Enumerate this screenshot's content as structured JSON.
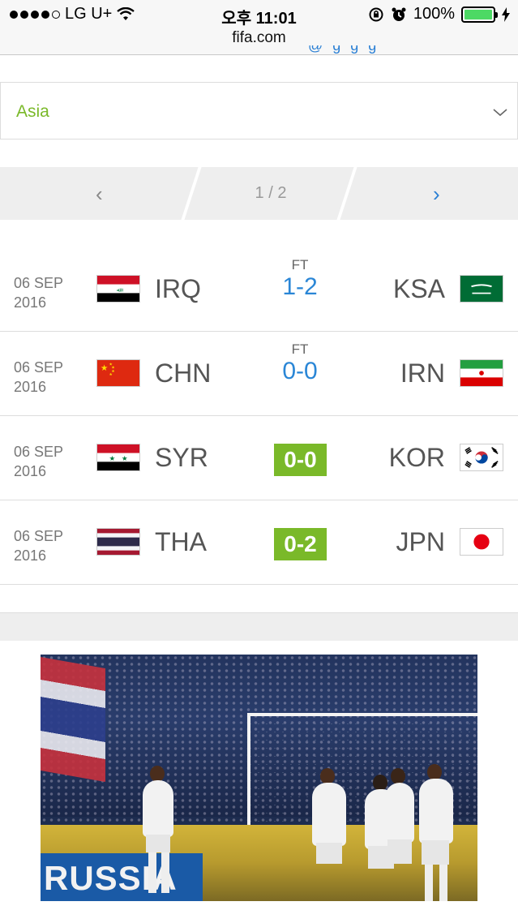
{
  "status_bar": {
    "carrier": "LG U+",
    "time": "오후 11:01",
    "url": "fifa.com",
    "battery": "100%"
  },
  "region_select": {
    "value": "Asia"
  },
  "pager": {
    "prev": "‹",
    "page": "1 / 2",
    "next": "›"
  },
  "matches": [
    {
      "date_day": "06 SEP",
      "date_year": "2016",
      "home": "IRQ",
      "away": "KSA",
      "status": "FT",
      "score": "1-2",
      "finished": true
    },
    {
      "date_day": "06 SEP",
      "date_year": "2016",
      "home": "CHN",
      "away": "IRN",
      "status": "FT",
      "score": "0-0",
      "finished": true
    },
    {
      "date_day": "06 SEP",
      "date_year": "2016",
      "home": "SYR",
      "away": "KOR",
      "status": "",
      "score": "0-0",
      "finished": false
    },
    {
      "date_day": "06 SEP",
      "date_year": "2016",
      "home": "THA",
      "away": "JPN",
      "status": "",
      "score": "0-2",
      "finished": false
    }
  ],
  "photo": {
    "board_text": "RUSSIA"
  },
  "colors": {
    "accent_green": "#7ab929",
    "link_blue": "#2a86d6"
  },
  "icons": {
    "wifi": "wifi-icon",
    "lock_rotation": "rotation-lock-icon",
    "alarm": "alarm-icon",
    "charging": "charging-bolt-icon",
    "dropdown": "chevron-down-icon"
  }
}
